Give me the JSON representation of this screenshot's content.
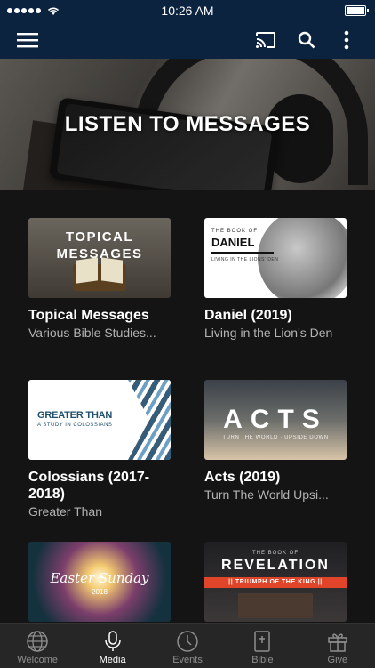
{
  "status_bar": {
    "time": "10:26 AM"
  },
  "app_bar": {
    "icons": [
      "menu-icon",
      "cast-icon",
      "search-icon",
      "more-vert-icon"
    ]
  },
  "hero": {
    "title": "LISTEN TO MESSAGES"
  },
  "items": [
    {
      "title": "Topical Messages",
      "subtitle": "Various Bible Studies...",
      "thumb_text": [
        "TOPICAL",
        "MESSAGES"
      ]
    },
    {
      "title": "Daniel (2019)",
      "subtitle": "Living in the Lion's Den",
      "thumb_text": {
        "small": "THE BOOK OF",
        "big": "DANIEL",
        "caption": "LIVING IN THE LIONS' DEN"
      }
    },
    {
      "title": "Colossians (2017-2018)",
      "subtitle": "Greater Than",
      "thumb_text": {
        "title": "GREATER THAN",
        "subtitle": "A STUDY IN COLOSSIANS"
      }
    },
    {
      "title": "Acts (2019)",
      "subtitle": "Turn The World Upsi...",
      "thumb_text": {
        "title": "ACTS",
        "caption": "TURN THE WORLD · UPSIDE DOWN"
      }
    },
    {
      "title": "",
      "subtitle": "",
      "thumb_text": {
        "title": "Easter Sunday",
        "year": "2018"
      }
    },
    {
      "title": "",
      "subtitle": "",
      "thumb_text": {
        "small": "THE BOOK OF",
        "big": "REVELATION",
        "bar": "|| TRIUMPH OF THE KING ||"
      }
    }
  ],
  "tab_bar": {
    "tabs": [
      {
        "label": "Welcome",
        "icon": "globe-icon",
        "active": false
      },
      {
        "label": "Media",
        "icon": "microphone-icon",
        "active": true
      },
      {
        "label": "Events",
        "icon": "clock-icon",
        "active": false
      },
      {
        "label": "Bible",
        "icon": "bible-icon",
        "active": false
      },
      {
        "label": "Give",
        "icon": "gift-icon",
        "active": false
      }
    ]
  },
  "colors": {
    "header": "#0c2340",
    "background": "#141414",
    "tabbar": "#262626",
    "accent": "#e0452a"
  }
}
